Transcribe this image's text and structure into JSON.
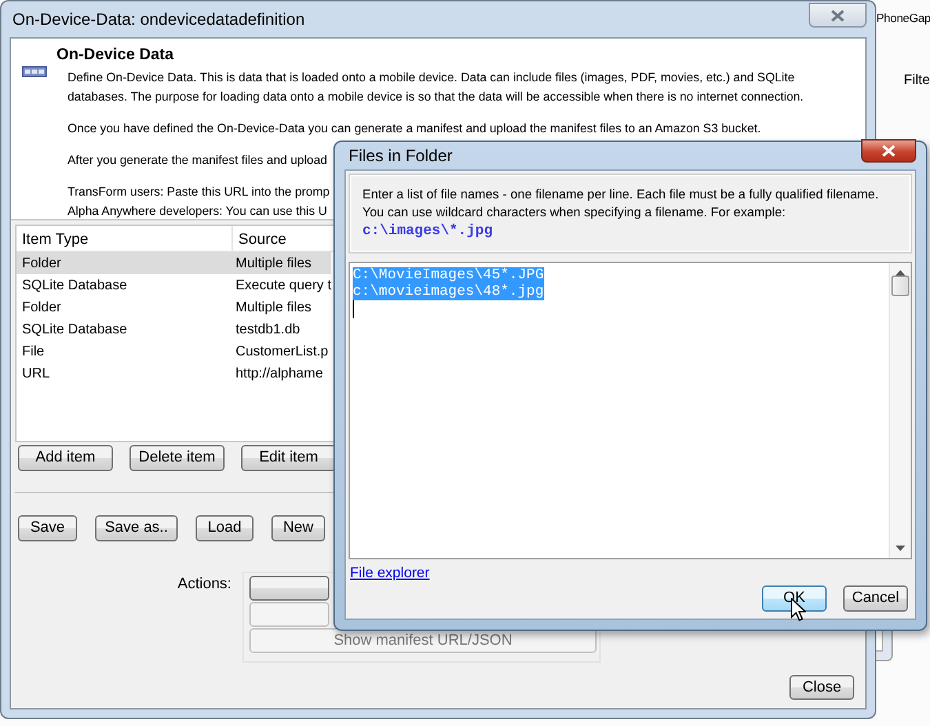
{
  "background": {
    "title": "PhoneGap",
    "filter_label": "Filte"
  },
  "main_window": {
    "title": "On-Device-Data: ondevicedatadefinition",
    "header": {
      "title": "On-Device Data",
      "paragraphs": [
        "Define On-Device Data. This is data that is loaded onto a mobile device. Data can include files (images, PDF, movies, etc.) and SQLite",
        "databases. The purpose for loading data onto a mobile device is so that the data will be accessible when there is no internet connection.",
        "Once you have defined the On-Device-Data you can generate a manifest and upload the manifest files to an Amazon S3 bucket.",
        "After you generate the manifest files and upload",
        "TransForm users: Paste this URL into the promp",
        "Alpha Anywhere developers: You can use this U"
      ]
    },
    "table": {
      "columns": [
        "Item Type",
        "Source"
      ],
      "rows": [
        {
          "cells": [
            "Folder",
            "Multiple files"
          ],
          "selected": true
        },
        {
          "cells": [
            "SQLite Database",
            "Execute query t"
          ],
          "selected": false
        },
        {
          "cells": [
            "Folder",
            "Multiple files"
          ],
          "selected": false
        },
        {
          "cells": [
            "SQLite Database",
            "testdb1.db"
          ],
          "selected": false
        },
        {
          "cells": [
            "File",
            "CustomerList.p"
          ],
          "selected": false
        },
        {
          "cells": [
            "URL",
            "http://alphame"
          ],
          "selected": false
        }
      ]
    },
    "item_buttons": [
      "Add item",
      "Delete item",
      "Edit item"
    ],
    "file_buttons": [
      "Save",
      "Save as..",
      "Load",
      "New"
    ],
    "actions": {
      "label": "Actions:",
      "buttons": [
        {
          "disabled": false
        },
        {
          "disabled": true
        },
        {
          "label": "Show manifest URL/JSON",
          "disabled": true
        }
      ]
    },
    "close_button": "Close"
  },
  "dialog": {
    "title": "Files in Folder",
    "instructions": [
      "Enter a list of file names - one filename per line. Each file must be a fully qualified filename.",
      "You can use wildcard characters when specifying a filename. For example:"
    ],
    "example": "c:\\images\\*.jpg",
    "file_list": {
      "lines": [
        "C:\\MovieImages\\45*.JPG",
        "c:\\movieimages\\48*.jpg"
      ],
      "selected": true
    },
    "link": "File explorer",
    "buttons": [
      {
        "label": "OK",
        "focused": true
      },
      {
        "label": "Cancel",
        "focused": false
      }
    ]
  }
}
